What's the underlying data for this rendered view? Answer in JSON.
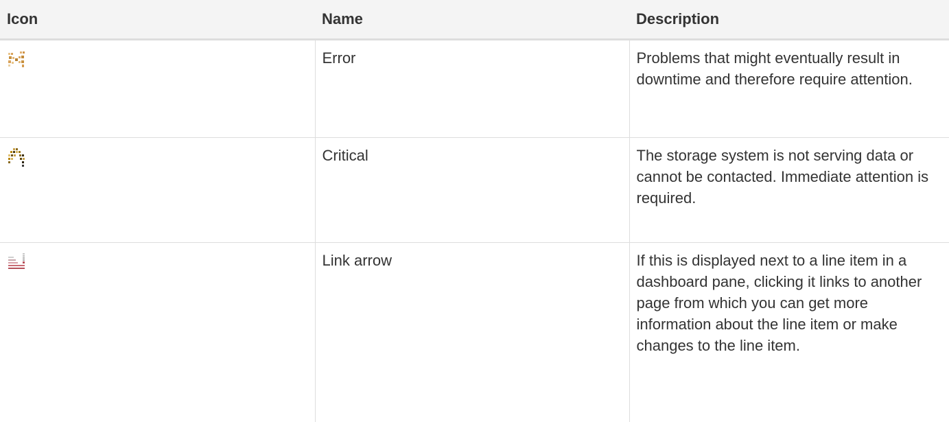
{
  "table": {
    "headers": {
      "icon": "Icon",
      "name": "Name",
      "description": "Description"
    },
    "rows": [
      {
        "icon": "error-icon",
        "name": "Error",
        "description": "Problems that might eventually result in downtime and therefore require attention."
      },
      {
        "icon": "critical-icon",
        "name": "Critical",
        "description": "The storage system is not serving data or cannot be contacted. Immediate attention is required."
      },
      {
        "icon": "link-arrow-icon",
        "name": "Link arrow",
        "description": "If this is displayed next to a line item in a dashboard pane, clicking it links to another page from which you can get more information about the line item or make changes to the line item."
      }
    ]
  },
  "colors": {
    "error_icon": "#d9a25a",
    "critical_icon": "#b8860b",
    "link_arrow_icon": "#b5505a"
  }
}
